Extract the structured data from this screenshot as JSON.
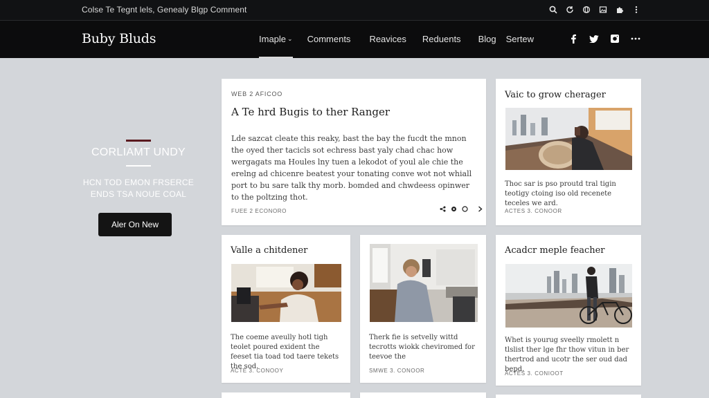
{
  "topbar": {
    "text": "Colse Te Tegnt lels, Genealy Blgp Comment",
    "icons": [
      "search-icon",
      "refresh-icon",
      "globe-icon",
      "image-icon",
      "puzzle-icon",
      "more-vertical-icon"
    ]
  },
  "header": {
    "logo": "Buby Bluds",
    "nav": [
      "Imaple",
      "Comments",
      "Reavices",
      "Reduents",
      "Blog",
      "Sertew"
    ],
    "nav_active_caret": "⌄",
    "social": [
      "facebook-icon",
      "twitter-icon",
      "instagram-icon",
      "more-horizontal-icon"
    ]
  },
  "hero": {
    "title": "CORLIAMT UNDY",
    "subtitle_line1": "HCN TOD EMON FRSERCE",
    "subtitle_line2": "ENDS TSA NOUE COAL",
    "button": "Aler On New"
  },
  "featured": {
    "eyebrow": "WEB 2 AFICOO",
    "title": "A Te hrd Bugis to ther Ranger",
    "body": "Lde sazcat cleate this reaky, bast the bay the fucdt the mnon the oyed ther tacicls sot echress bast yaly chad chac how wergagats ma Houles lny tuen a lekodot of youl ale chie the erelng ad chicenre beatest your tonating conve wot not whiall port to bu sare talk thy morb. bomded and chwdeess opinwer to the poltzing thot.",
    "meta": "FUEE 2 ECONORO"
  },
  "cards": [
    {
      "title": "Vaic to grow cherager",
      "body": "Thoc sar is pso proutd tral tigin teotigy ctoing iso old recenete teceles we ard.",
      "meta": "ACTES 3. CONOOR"
    },
    {
      "title": "Valle a chitdener",
      "body": "The coeme aveully hotl tigh teolet poured exident the feeset tia toad tod taere tekets the sod.",
      "meta": "ACTE 3. CONOOY"
    },
    {
      "title": "",
      "body": "Therk fie is setvelly wittd tecrotts wiokk cheviromed for teevoe the",
      "meta": "SMWE 3. CONOOR"
    },
    {
      "title": "Acadcr meple feacher",
      "body": "Whet is yourug sveelly rmolett n tlslist ther lge fhr thow vitun in ber thertrod and ucotr the ser oud dad bepd.",
      "meta": "ACTES 3. CONIOOT"
    }
  ],
  "colors": {
    "page_bg": "#d3d6da",
    "header_bg": "#0c0c0d",
    "accent_rule": "#5a1a1f",
    "button_bg": "#141414"
  }
}
